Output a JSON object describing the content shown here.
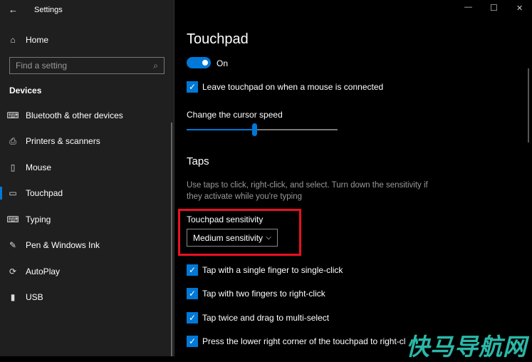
{
  "window": {
    "title": "Settings",
    "minimize": "—",
    "maximize": "☐",
    "close": "✕"
  },
  "sidebar": {
    "home": "Home",
    "search_placeholder": "Find a setting",
    "section": "Devices",
    "items": [
      {
        "label": "Bluetooth & other devices",
        "icon": "⌨"
      },
      {
        "label": "Printers & scanners",
        "icon": "⎙"
      },
      {
        "label": "Mouse",
        "icon": "▯"
      },
      {
        "label": "Touchpad",
        "icon": "▭",
        "selected": true
      },
      {
        "label": "Typing",
        "icon": "⌨"
      },
      {
        "label": "Pen & Windows Ink",
        "icon": "✎"
      },
      {
        "label": "AutoPlay",
        "icon": "⟳"
      },
      {
        "label": "USB",
        "icon": "▮"
      }
    ]
  },
  "main": {
    "title": "Touchpad",
    "toggle_label": "On",
    "toggle_on": true,
    "leave_on": "Leave touchpad on when a mouse is connected",
    "cursor_speed_label": "Change the cursor speed",
    "cursor_speed_percent": 45,
    "taps_heading": "Taps",
    "taps_desc": "Use taps to click, right-click, and select. Turn down the sensitivity if they activate while you're typing",
    "sensitivity_label": "Touchpad sensitivity",
    "sensitivity_value": "Medium sensitivity",
    "checks": [
      "Tap with a single finger to single-click",
      "Tap with two fingers to right-click",
      "Tap twice and drag to multi-select",
      "Press the lower right corner of the touchpad to right-click"
    ]
  },
  "accent": "#0078d7",
  "highlight": "#e81123",
  "watermark": "快马导航网"
}
